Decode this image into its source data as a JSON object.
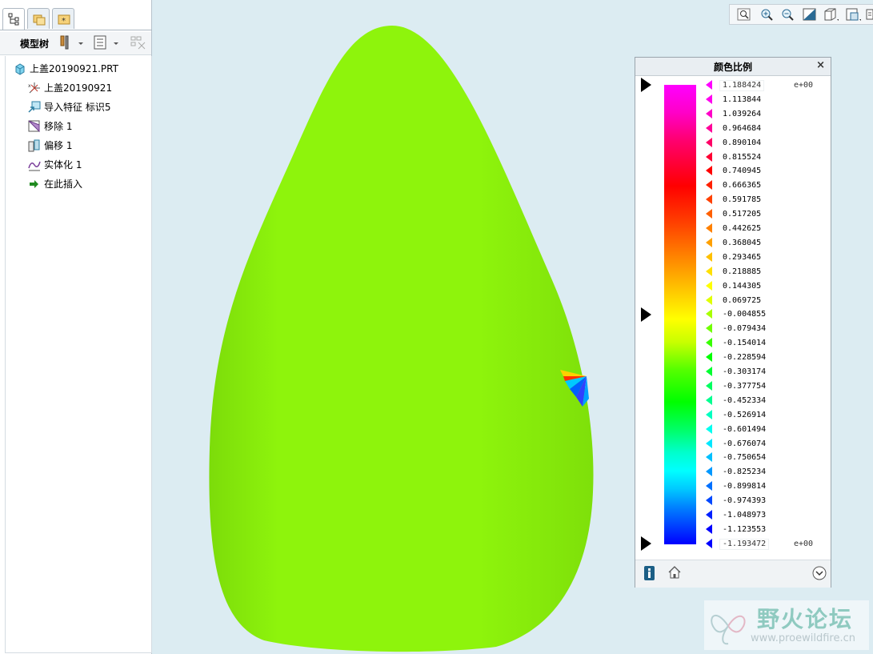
{
  "model_tree": {
    "title": "模型树",
    "items": [
      {
        "label": "上盖20190921.PRT",
        "icon": "part-cube-icon"
      },
      {
        "label": "上盖20190921",
        "icon": "coordinate-system-icon"
      },
      {
        "label": "导入特征 标识5",
        "icon": "import-feature-icon"
      },
      {
        "label": "移除 1",
        "icon": "remove-feature-icon"
      },
      {
        "label": "偏移 1",
        "icon": "offset-feature-icon"
      },
      {
        "label": "实体化 1",
        "icon": "solidify-feature-icon"
      },
      {
        "label": "在此插入",
        "icon": "insert-here-arrow-icon"
      }
    ]
  },
  "view_toolbar": [
    "refit-icon",
    "zoom-in-icon",
    "zoom-out-icon",
    "repaint-icon",
    "display-style-icon",
    "saved-views-icon",
    "more-icon"
  ],
  "color_scale": {
    "title": "颜色比例",
    "max_value": "1.188424",
    "min_value": "-1.193472",
    "exponent_top": "e+00",
    "exponent_bottom": "e+00",
    "values": [
      "1.113844",
      "1.039264",
      "0.964684",
      "0.890104",
      "0.815524",
      "0.740945",
      "0.666365",
      "0.591785",
      "0.517205",
      "0.442625",
      "0.368045",
      "0.293465",
      "0.218885",
      "0.144305",
      "0.069725",
      "-0.004855",
      "-0.079434",
      "-0.154014",
      "-0.228594",
      "-0.303174",
      "-0.377754",
      "-0.452334",
      "-0.526914",
      "-0.601494",
      "-0.676074",
      "-0.750654",
      "-0.825234",
      "-0.899814",
      "-0.974393",
      "-1.048973",
      "-1.123553"
    ],
    "marker_colors": [
      "#ff00ff",
      "#ff00ee",
      "#ff00c8",
      "#ff0099",
      "#ff0066",
      "#ff0033",
      "#ff0000",
      "#ff2000",
      "#ff4000",
      "#ff6000",
      "#ff8000",
      "#ffa000",
      "#ffc000",
      "#ffe000",
      "#ffff00",
      "#e0ff00",
      "#a8ff00",
      "#70ff00",
      "#38ff00",
      "#00ff00",
      "#00ff30",
      "#00ff60",
      "#00ff90",
      "#00ffc0",
      "#00fff0",
      "#00e8ff",
      "#00c0ff",
      "#0098ff",
      "#0070ff",
      "#0048ff",
      "#0020ff",
      "#0000ff",
      "#0000ff"
    ]
  },
  "watermark": {
    "name": "野火论坛",
    "url": "www.proewildfire.cn"
  },
  "colors": {
    "model_fill": "#8cf70a",
    "viewport_bg": "#dcecf2"
  }
}
